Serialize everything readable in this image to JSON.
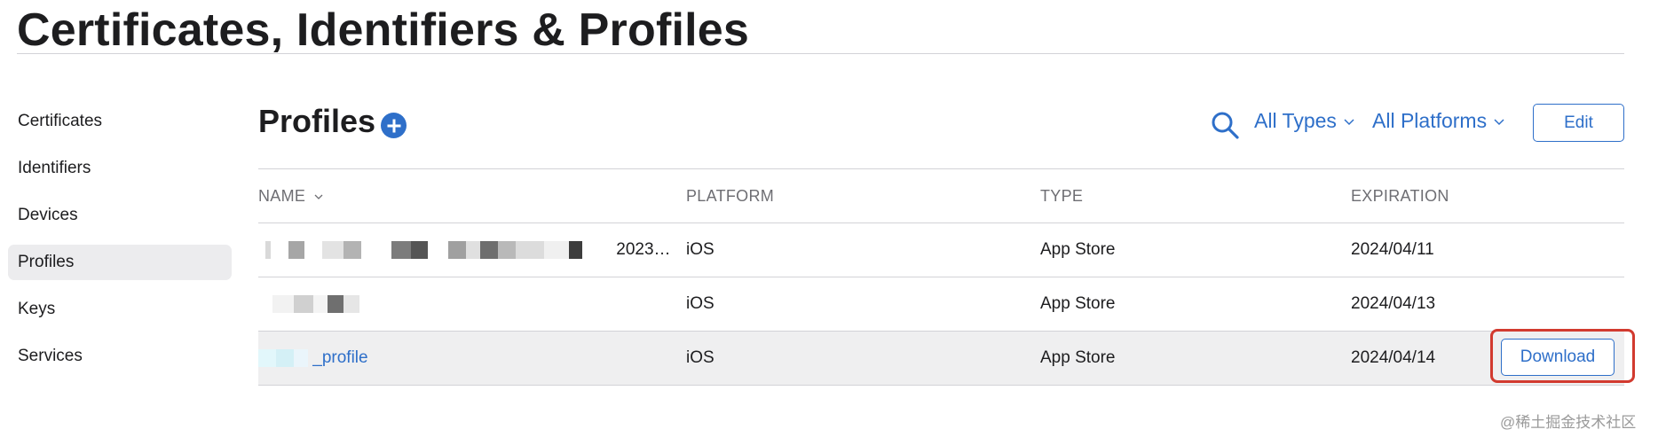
{
  "page_title": "Certificates, Identifiers & Profiles",
  "sidebar": {
    "items": [
      {
        "label": "Certificates",
        "active": false
      },
      {
        "label": "Identifiers",
        "active": false
      },
      {
        "label": "Devices",
        "active": false
      },
      {
        "label": "Profiles",
        "active": true
      },
      {
        "label": "Keys",
        "active": false
      },
      {
        "label": "Services",
        "active": false
      }
    ]
  },
  "section": {
    "title": "Profiles",
    "add_icon": "plus-circle-icon",
    "search_icon": "search-icon",
    "filter_types": "All Types",
    "filter_platforms": "All Platforms",
    "edit_label": "Edit"
  },
  "table": {
    "columns": {
      "name": "NAME",
      "platform": "PLATFORM",
      "type": "TYPE",
      "expiration": "EXPIRATION"
    },
    "rows": [
      {
        "name_suffix": "2023…",
        "platform": "iOS",
        "type": "App Store",
        "expiration": "2024/04/11"
      },
      {
        "name_suffix": "",
        "platform": "iOS",
        "type": "App Store",
        "expiration": "2024/04/13"
      },
      {
        "name_suffix": "_profile",
        "platform": "iOS",
        "type": "App Store",
        "expiration": "2024/04/14",
        "action": "Download"
      }
    ]
  },
  "watermark": "@稀土掘金技术社区",
  "colors": {
    "accent": "#2e6fc9",
    "highlight_border": "#d23a2f",
    "selected_row": "#efeff0"
  }
}
